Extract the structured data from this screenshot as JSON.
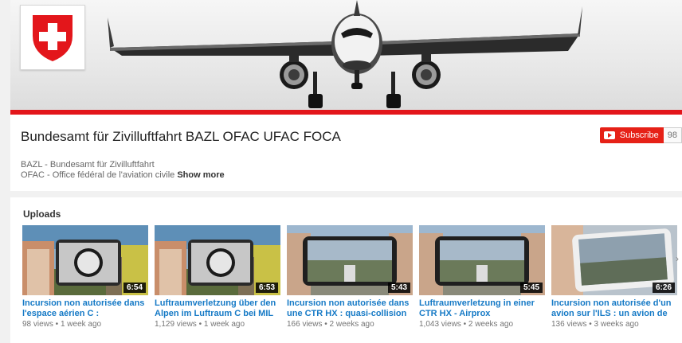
{
  "channel": {
    "name": "Bundesamt für Zivilluftfahrt BAZL OFAC UFAC FOCA",
    "subscribe_label": "Subscribe",
    "subscriber_count": "98",
    "description_line1": "BAZL - Bundesamt für Zivilluftfahrt",
    "description_line2": "OFAC - Office fédéral de l'aviation civile",
    "show_more": "Show more"
  },
  "uploads": {
    "title": "Uploads",
    "videos": [
      {
        "title": "Incursion non autorisée dans l'espace aérien C : identification...",
        "views": "98 views",
        "age": "1 week ago",
        "duration": "6:54"
      },
      {
        "title": "Luftraumverletzung über den Alpen im Luftraum C bei MIL ON...",
        "views": "1,129 views",
        "age": "1 week ago",
        "duration": "6:53"
      },
      {
        "title": "Incursion non autorisée dans une CTR HX : quasi-collision",
        "views": "166 views",
        "age": "2 weeks ago",
        "duration": "5:43"
      },
      {
        "title": "Luftraumverletzung in einer CTR HX - Airprox",
        "views": "1,043 views",
        "age": "2 weeks ago",
        "duration": "5:45"
      },
      {
        "title": "Incursion non autorisée d'un avion sur l'ILS : un avion de lign...",
        "views": "136 views",
        "age": "3 weeks ago",
        "duration": "6:26"
      }
    ]
  },
  "colors": {
    "accent_red": "#e62117",
    "link_blue": "#167ac6",
    "banner_red": "#e3161b"
  },
  "icons": {
    "logo": "swiss-cross-shield-icon",
    "subscribe": "youtube-play-icon",
    "next": "chevron-right-icon"
  }
}
